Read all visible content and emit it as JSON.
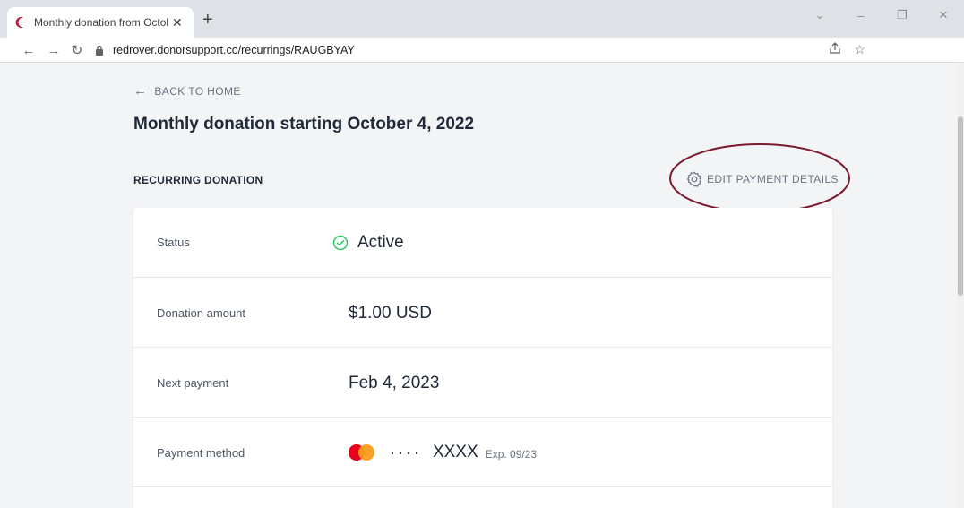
{
  "browser": {
    "tab_title": "Monthly donation from October",
    "url": "redrover.donorsupport.co/recurrings/RAUGBYAY"
  },
  "page": {
    "back_label": "BACK TO HOME",
    "title": "Monthly donation starting October 4, 2022",
    "section_label": "RECURRING DONATION",
    "edit_label": "EDIT PAYMENT DETAILS"
  },
  "details": {
    "status_label": "Status",
    "status_value": "Active",
    "amount_label": "Donation amount",
    "amount_value": "$1.00 USD",
    "next_label": "Next payment",
    "next_value": "Feb 4, 2023",
    "method_label": "Payment method",
    "method_dots": "····",
    "method_masked": "XXXX",
    "method_exp": "Exp. 09/23"
  },
  "colors": {
    "active_green": "#22c55e",
    "highlight_ring": "#7a1b2e",
    "brand_icon": "#b01e3a"
  },
  "icons": [
    "crescent-favicon-icon",
    "close-icon",
    "plus-icon",
    "back-icon",
    "forward-icon",
    "reload-icon",
    "lock-icon",
    "share-icon",
    "star-icon",
    "arrow-left-icon",
    "gear-icon",
    "check-circle-icon",
    "mastercard-icon"
  ]
}
